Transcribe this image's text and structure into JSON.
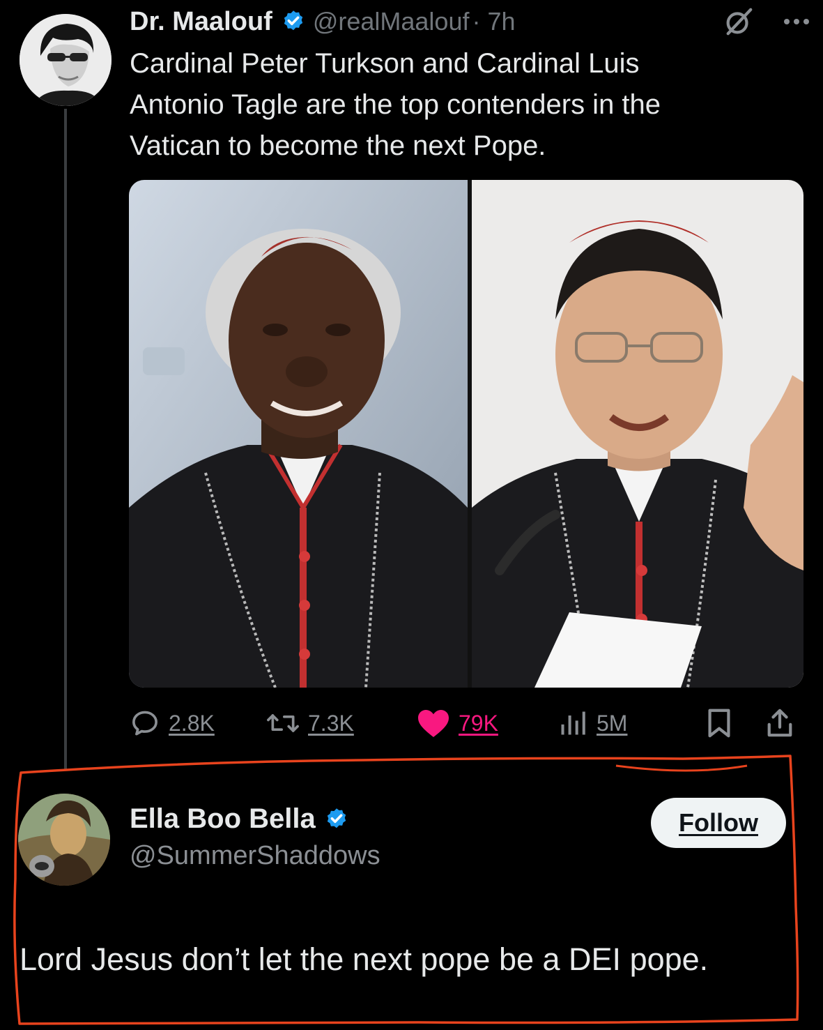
{
  "tweet": {
    "author_name": "Dr. Maalouf",
    "author_handle": "@realMaalouf",
    "time": "· 7h",
    "text": "Cardinal Peter Turkson and Cardinal Luis\nAntonio Tagle are the top contenders in the\nVatican to become the next Pope.",
    "media": [
      {
        "subject": "cardinal-portrait-left"
      },
      {
        "subject": "cardinal-portrait-right"
      }
    ],
    "actions": {
      "replies": "2.8K",
      "reposts": "7.3K",
      "likes": "79K",
      "views": "5M"
    }
  },
  "reply": {
    "author_name": "Ella Boo Bella",
    "author_handle": "@SummerShaddows",
    "follow_label": "Follow",
    "text": "Lord Jesus don’t let the next pope be a DEI pope."
  },
  "colors": {
    "background": "#000000",
    "primary_text": "#e7e9ea",
    "secondary_text": "#71767b",
    "verified_blue": "#1d9bf0",
    "like_pink": "#f91880",
    "highlight_red": "#e8431d",
    "follow_button_bg": "#eff3f4"
  },
  "icons": {
    "verified": "verified-badge-icon",
    "grok": "grok-icon",
    "more": "more-dots-icon",
    "reply": "reply-bubble-icon",
    "repost": "repost-arrows-icon",
    "like": "heart-icon",
    "views": "views-bars-icon",
    "bookmark": "bookmark-icon",
    "share": "share-icon"
  }
}
